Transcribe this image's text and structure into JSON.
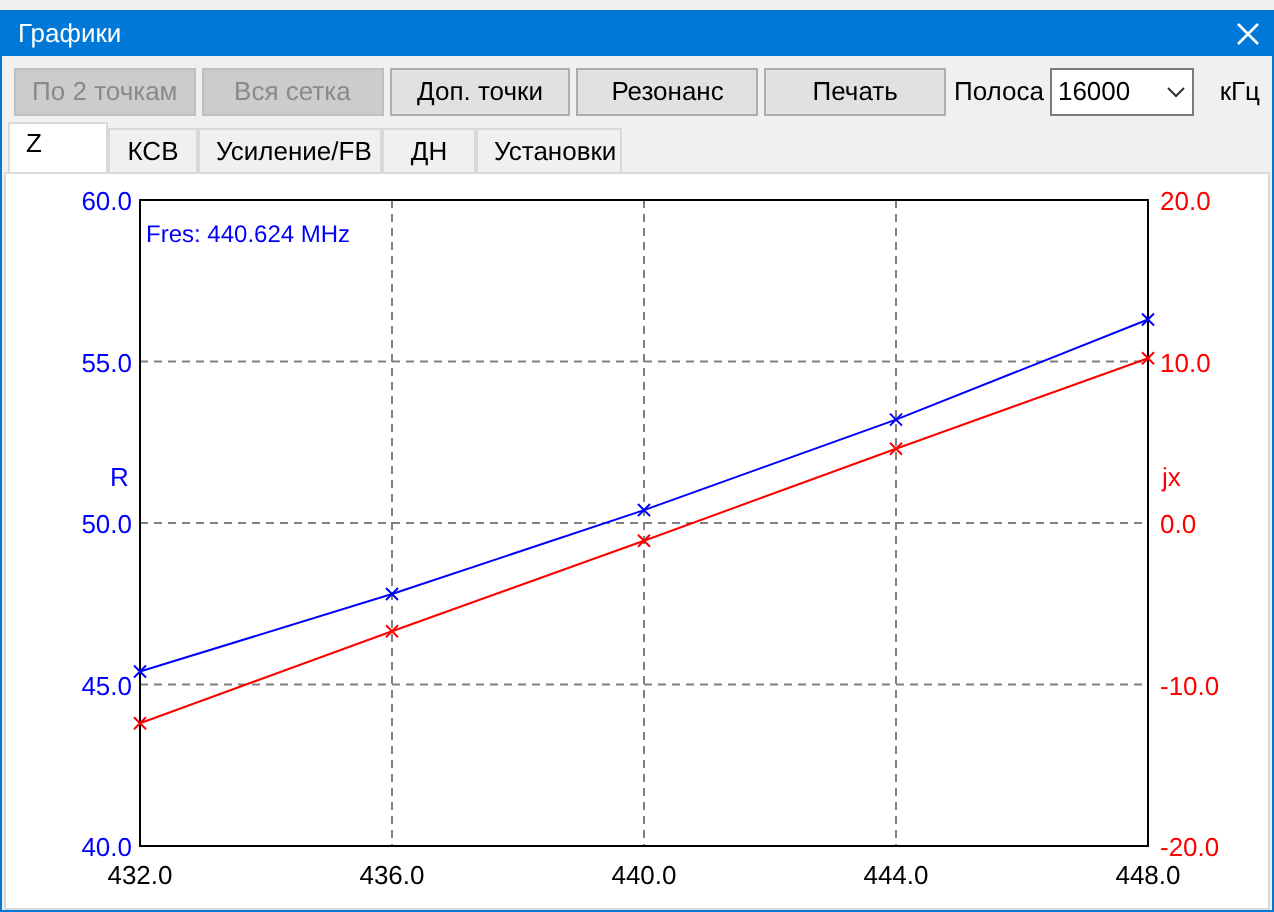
{
  "window": {
    "title": "Графики"
  },
  "toolbar": {
    "buttons": [
      {
        "label": "По 2 точкам",
        "disabled": true
      },
      {
        "label": "Вся сетка",
        "disabled": true
      },
      {
        "label": "Доп. точки",
        "disabled": false
      },
      {
        "label": "Резонанс",
        "disabled": false
      },
      {
        "label": "Печать",
        "disabled": false
      }
    ],
    "band": {
      "label": "Полоса",
      "value": "16000",
      "unit": "кГц"
    }
  },
  "tabs": [
    {
      "label": "Z",
      "selected": true
    },
    {
      "label": "КСВ",
      "selected": false
    },
    {
      "label": "Усиление/FB",
      "selected": false
    },
    {
      "label": "ДН",
      "selected": false
    },
    {
      "label": "Установки",
      "selected": false
    }
  ],
  "plot": {
    "annotation": "Fres: 440.624 MHz",
    "chart_data": {
      "type": "line",
      "grid": true,
      "x": [
        432,
        436,
        440,
        444,
        448
      ],
      "xlim": [
        432,
        448
      ],
      "ylim": [
        40,
        60
      ],
      "y2lim": [
        -20,
        20
      ],
      "xticks": [
        {
          "value": 432,
          "label": "432.0"
        },
        {
          "value": 436,
          "label": "436.0"
        },
        {
          "value": 440,
          "label": "440.0"
        },
        {
          "value": 444,
          "label": "444.0"
        },
        {
          "value": 448,
          "label": "448.0"
        }
      ],
      "yticks": [
        {
          "value": 40,
          "label": "40.0"
        },
        {
          "value": 45,
          "label": "45.0"
        },
        {
          "value": 50,
          "label": "50.0"
        },
        {
          "value": 55,
          "label": "55.0"
        },
        {
          "value": 60,
          "label": "60.0"
        }
      ],
      "y2ticks": [
        {
          "value": -20,
          "label": "-20.0"
        },
        {
          "value": -10,
          "label": "-10.0"
        },
        {
          "value": 0,
          "label": "0.0"
        },
        {
          "value": 10,
          "label": "10.0"
        },
        {
          "value": 20,
          "label": "20.0"
        }
      ],
      "series": [
        {
          "name": "R",
          "color": "#0000ff",
          "marker": "x",
          "values": [
            45.4,
            47.8,
            50.4,
            53.2,
            56.3
          ]
        },
        {
          "name": "jx",
          "color": "#ff0000",
          "axis": "y2",
          "marker": "x",
          "values": [
            -12.4,
            -6.7,
            -1.1,
            4.6,
            10.2
          ]
        }
      ]
    }
  }
}
